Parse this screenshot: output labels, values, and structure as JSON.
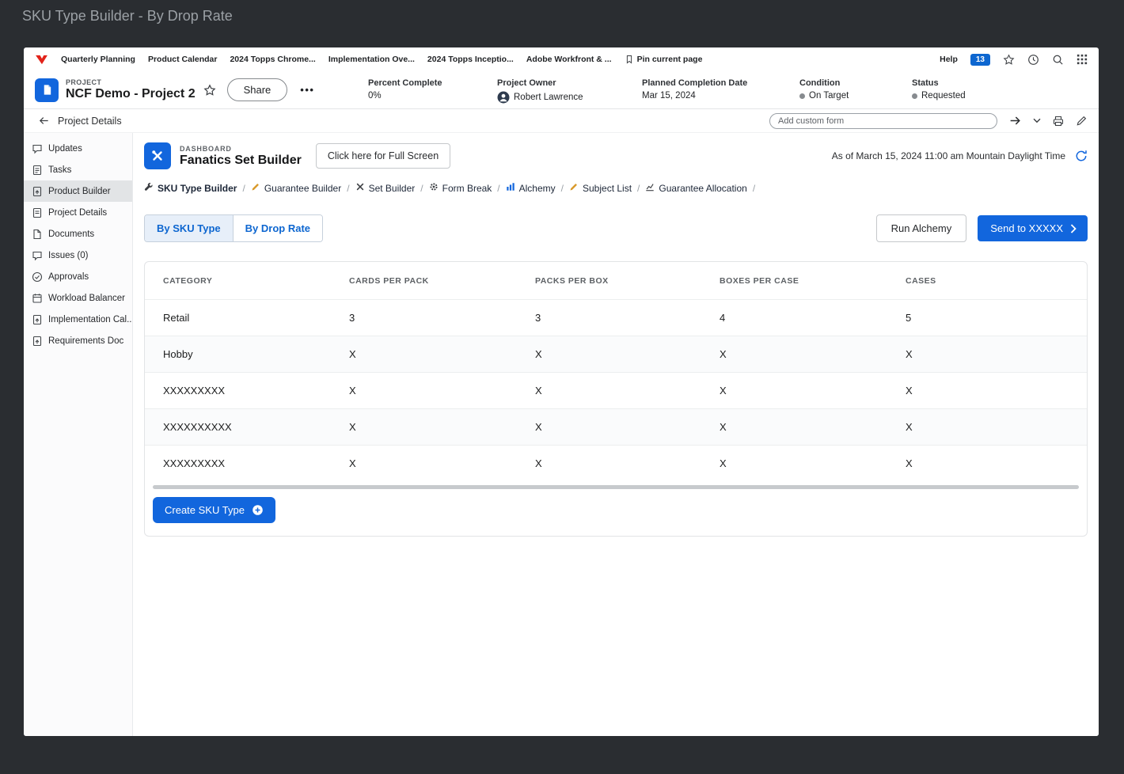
{
  "window": {
    "caption": "SKU Type Builder - By Drop Rate"
  },
  "bookmarks_bar": {
    "items": [
      "Quarterly Planning",
      "Product Calendar",
      "2024 Topps Chrome...",
      "Implementation Ove...",
      "2024 Topps Inceptio...",
      "Adobe Workfront & ..."
    ],
    "pin_label": "Pin current page",
    "help_label": "Help",
    "notification_count": "13"
  },
  "project_header": {
    "eyebrow": "PROJECT",
    "title": "NCF Demo - Project 2",
    "share_label": "Share",
    "fields": [
      {
        "label": "Percent Complete",
        "value": "0%"
      },
      {
        "label": "Project Owner",
        "value": "Robert Lawrence"
      },
      {
        "label": "Planned Completion Date",
        "value": "Mar 15, 2024"
      },
      {
        "label": "Condition",
        "value": "On Target"
      },
      {
        "label": "Status",
        "value": "Requested"
      }
    ]
  },
  "toolbar": {
    "back_label": "Project Details",
    "custom_form_placeholder": "Add custom form"
  },
  "sidebar": {
    "items": [
      {
        "label": "Updates"
      },
      {
        "label": "Tasks"
      },
      {
        "label": "Product Builder",
        "selected": true
      },
      {
        "label": "Project Details"
      },
      {
        "label": "Documents"
      },
      {
        "label": "Issues (0)"
      },
      {
        "label": "Approvals"
      },
      {
        "label": "Workload Balancer"
      },
      {
        "label": "Implementation Cal..."
      },
      {
        "label": "Requirements Doc"
      }
    ]
  },
  "dashboard": {
    "eyebrow": "DASHBOARD",
    "title": "Fanatics Set Builder",
    "fullscreen_label": "Click here for Full Screen",
    "asof": "As of March 15, 2024 11:00 am Mountain Daylight Time",
    "nav_links": [
      {
        "label": "SKU Type Builder",
        "icon": "wrench-icon"
      },
      {
        "label": "Guarantee Builder",
        "icon": "pencil-icon"
      },
      {
        "label": "Set Builder",
        "icon": "tools-icon"
      },
      {
        "label": "Form Break",
        "icon": "gear-icon"
      },
      {
        "label": "Alchemy",
        "icon": "bar-chart-icon"
      },
      {
        "label": "Subject List",
        "icon": "pencil-icon"
      },
      {
        "label": "Guarantee Allocation",
        "icon": "line-chart-icon"
      }
    ],
    "tabs": [
      {
        "label": "By SKU Type",
        "selected": true
      },
      {
        "label": "By Drop Rate",
        "selected": false
      }
    ],
    "run_alchemy_label": "Run Alchemy",
    "send_label": "Send to XXXXX",
    "create_label": "Create SKU Type"
  },
  "table": {
    "columns": [
      "CATEGORY",
      "CARDS PER PACK",
      "PACKS PER BOX",
      "BOXES PER CASE",
      "CASES"
    ],
    "rows": [
      [
        "Retail",
        "3",
        "3",
        "4",
        "5"
      ],
      [
        "Hobby",
        "X",
        "X",
        "X",
        "X"
      ],
      [
        "XXXXXXXXX",
        "X",
        "X",
        "X",
        "X"
      ],
      [
        "XXXXXXXXXX",
        "X",
        "X",
        "X",
        "X"
      ],
      [
        "XXXXXXXXX",
        "X",
        "X",
        "X",
        "X"
      ]
    ]
  },
  "colors": {
    "accent_blue": "#1266dd",
    "badge_blue": "#0d66d0",
    "logo_red": "#e2231a",
    "selected_tab_bg": "#e7eff9",
    "desktop_bg": "#2a2d31"
  }
}
